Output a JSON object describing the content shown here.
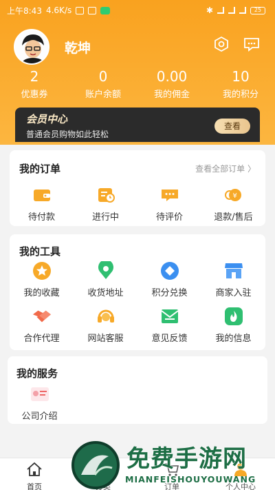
{
  "status_bar": {
    "time": "上午8:43",
    "speed": "4.6K/s",
    "battery": "25"
  },
  "profile": {
    "username": "乾坤"
  },
  "stats": [
    {
      "value": "2",
      "label": "优惠券"
    },
    {
      "value": "0",
      "label": "账户余额"
    },
    {
      "value": "0.00",
      "label": "我的佣金"
    },
    {
      "value": "10",
      "label": "我的积分"
    }
  ],
  "vip": {
    "title": "会员中心",
    "subtitle": "普通会员购物如此轻松",
    "button": "查看"
  },
  "orders": {
    "title": "我的订单",
    "more": "查看全部订单 〉",
    "items": [
      {
        "label": "待付款",
        "icon": "wallet-icon"
      },
      {
        "label": "进行中",
        "icon": "order-progress-icon"
      },
      {
        "label": "待评价",
        "icon": "comment-icon"
      },
      {
        "label": "退款/售后",
        "icon": "refund-icon"
      }
    ]
  },
  "tools": {
    "title": "我的工具",
    "items": [
      {
        "label": "我的收藏",
        "icon": "star-icon",
        "color": "#f7a928"
      },
      {
        "label": "收货地址",
        "icon": "location-icon",
        "color": "#2fbf71"
      },
      {
        "label": "积分兑换",
        "icon": "diamond-icon",
        "color": "#3b8ff0"
      },
      {
        "label": "商家入驻",
        "icon": "shop-icon",
        "color": "#3b8ff0"
      },
      {
        "label": "合作代理",
        "icon": "handshake-icon",
        "color": "#f16a4a"
      },
      {
        "label": "网站客服",
        "icon": "headset-icon",
        "color": "#f7a928"
      },
      {
        "label": "意见反馈",
        "icon": "mail-icon",
        "color": "#2fbf71"
      },
      {
        "label": "我的信息",
        "icon": "flame-icon",
        "color": "#2fbf71"
      }
    ]
  },
  "services": {
    "title": "我的服务",
    "items": [
      {
        "label": "公司介绍",
        "icon": "company-icon"
      }
    ]
  },
  "tabbar": [
    {
      "label": "首页",
      "icon": "home-icon"
    },
    {
      "label": "分类",
      "icon": "category-icon"
    },
    {
      "label": "订单",
      "icon": "cart-icon"
    },
    {
      "label": "个人中心",
      "icon": "user-icon"
    }
  ],
  "watermark": {
    "title": "免费手游网",
    "subtitle": "MIANFEISHOUYOUWANG"
  }
}
